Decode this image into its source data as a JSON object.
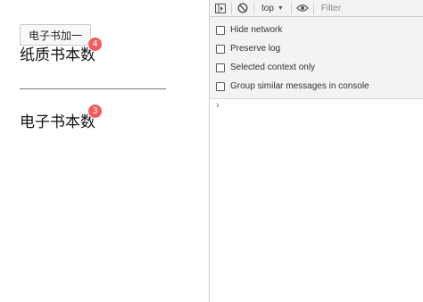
{
  "app": {
    "add_button_label": "电子书加一",
    "paper_books": {
      "label": "纸质书本数",
      "count": "4"
    },
    "ebooks": {
      "label": "电子书本数",
      "count": "3"
    }
  },
  "console": {
    "context_label": "top",
    "filter_placeholder": "Filter",
    "options": [
      {
        "label": "Hide network",
        "checked": false
      },
      {
        "label": "Preserve log",
        "checked": false
      },
      {
        "label": "Selected context only",
        "checked": false
      },
      {
        "label": "Group similar messages in console",
        "checked": false
      }
    ],
    "prompt_symbol": "›"
  },
  "colors": {
    "badge": "#f25b5b",
    "console_prompt": "#3a7bd5"
  }
}
